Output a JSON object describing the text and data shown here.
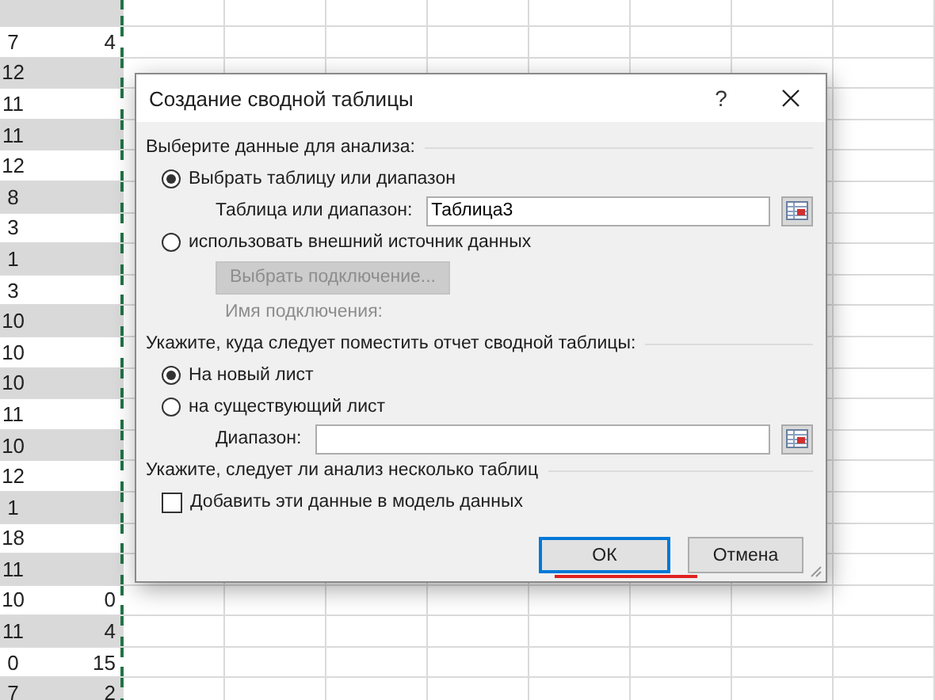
{
  "sheet": {
    "rows": [
      {
        "col_a": "7",
        "col_b": "4"
      },
      {
        "col_a": "12"
      },
      {
        "col_a": "11"
      },
      {
        "col_a": "11"
      },
      {
        "col_a": "12"
      },
      {
        "col_a": "8"
      },
      {
        "col_a": "3"
      },
      {
        "col_a": "1"
      },
      {
        "col_a": "3"
      },
      {
        "col_a": "10"
      },
      {
        "col_a": "10"
      },
      {
        "col_a": "10"
      },
      {
        "col_a": "11"
      },
      {
        "col_a": "10"
      },
      {
        "col_a": "12"
      },
      {
        "col_a": "1"
      },
      {
        "col_a": "18"
      },
      {
        "col_a": "11"
      },
      {
        "col_a": "10",
        "col_b": "0"
      },
      {
        "col_a": "11",
        "col_b": "4"
      },
      {
        "col_a": "0",
        "col_b": "15"
      },
      {
        "col_a": "7",
        "col_b": "2"
      }
    ]
  },
  "dialog": {
    "title": "Создание сводной таблицы",
    "help": "?",
    "sections": [
      {
        "heading": "Выберите данные для анализа:",
        "items": [
          {
            "kind": "radio",
            "label": "Выбрать таблицу или диапазон",
            "selected": true
          },
          {
            "kind": "field",
            "label": "Таблица или диапазон:",
            "value": "Таблица3"
          },
          {
            "kind": "radio",
            "label": "использовать внешний источник данных",
            "selected": false
          },
          {
            "kind": "button",
            "label": "Выбрать подключение...",
            "disabled": true
          },
          {
            "kind": "note",
            "label": "Имя подключения:",
            "disabled": true
          }
        ]
      },
      {
        "heading": "Укажите, куда следует поместить отчет сводной таблицы:",
        "items": [
          {
            "kind": "radio",
            "label": "На новый лист",
            "selected": true
          },
          {
            "kind": "radio",
            "label": "на существующий лист",
            "selected": false
          },
          {
            "kind": "field",
            "label": "Диапазон:",
            "value": ""
          }
        ]
      },
      {
        "heading": "Укажите, следует ли анализ несколько таблиц",
        "items": [
          {
            "kind": "checkbox",
            "label": "Добавить эти данные в модель данных",
            "checked": false
          }
        ]
      }
    ],
    "buttons": [
      {
        "label": "ОК",
        "default": true
      },
      {
        "label": "Отмена",
        "default": false
      }
    ]
  }
}
